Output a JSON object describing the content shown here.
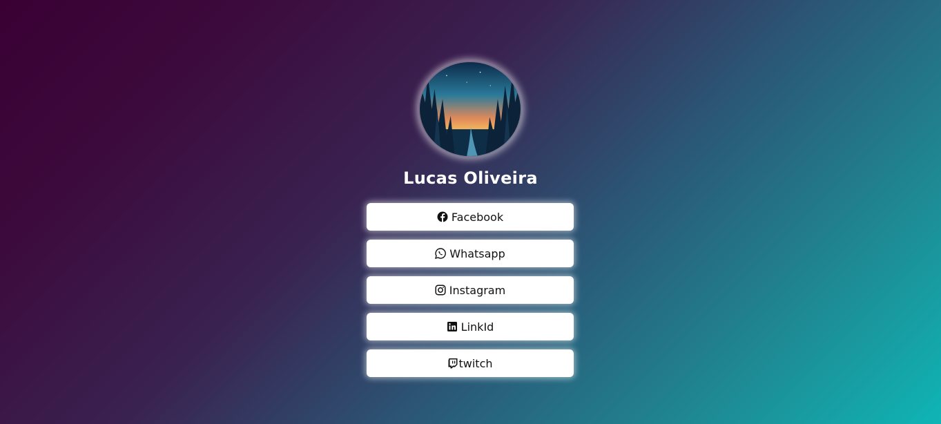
{
  "profile": {
    "name": "Lucas Oliveira",
    "avatar_icon": "forest-landscape-avatar"
  },
  "links": [
    {
      "label": "Facebook",
      "icon": "facebook-icon"
    },
    {
      "label": "Whatsapp",
      "icon": "whatsapp-icon"
    },
    {
      "label": "Instagram",
      "icon": "instagram-icon"
    },
    {
      "label": "LinkId",
      "icon": "linkedin-icon"
    },
    {
      "label": "twitch",
      "icon": "twitch-icon"
    }
  ],
  "colors": {
    "background_start": "#3a0034",
    "background_end": "#0fb5b5",
    "button_bg": "#ffffff",
    "name_text": "#ffffff"
  }
}
